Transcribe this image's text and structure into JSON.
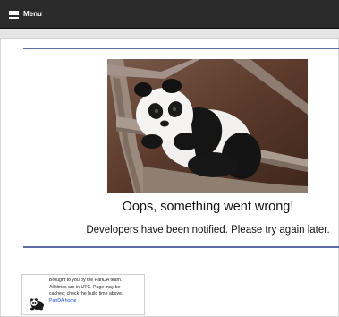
{
  "header": {
    "menu_label": "Menu"
  },
  "error": {
    "title": "Oops, something went wrong!",
    "message": "Developers have been notified. Please try again later."
  },
  "footer": {
    "line1": "Brought to you by the PanDA team.",
    "line2": "All times are in UTC. Page may be",
    "line3": "cached; check the build time above.",
    "link_label": "PanDA home"
  },
  "icons": {
    "menu": "hamburger-icon",
    "logo": "panda-logo"
  },
  "colors": {
    "topbar": "#2b2b2b",
    "rule": "#5a6ea3",
    "link": "#1a4fd6"
  }
}
